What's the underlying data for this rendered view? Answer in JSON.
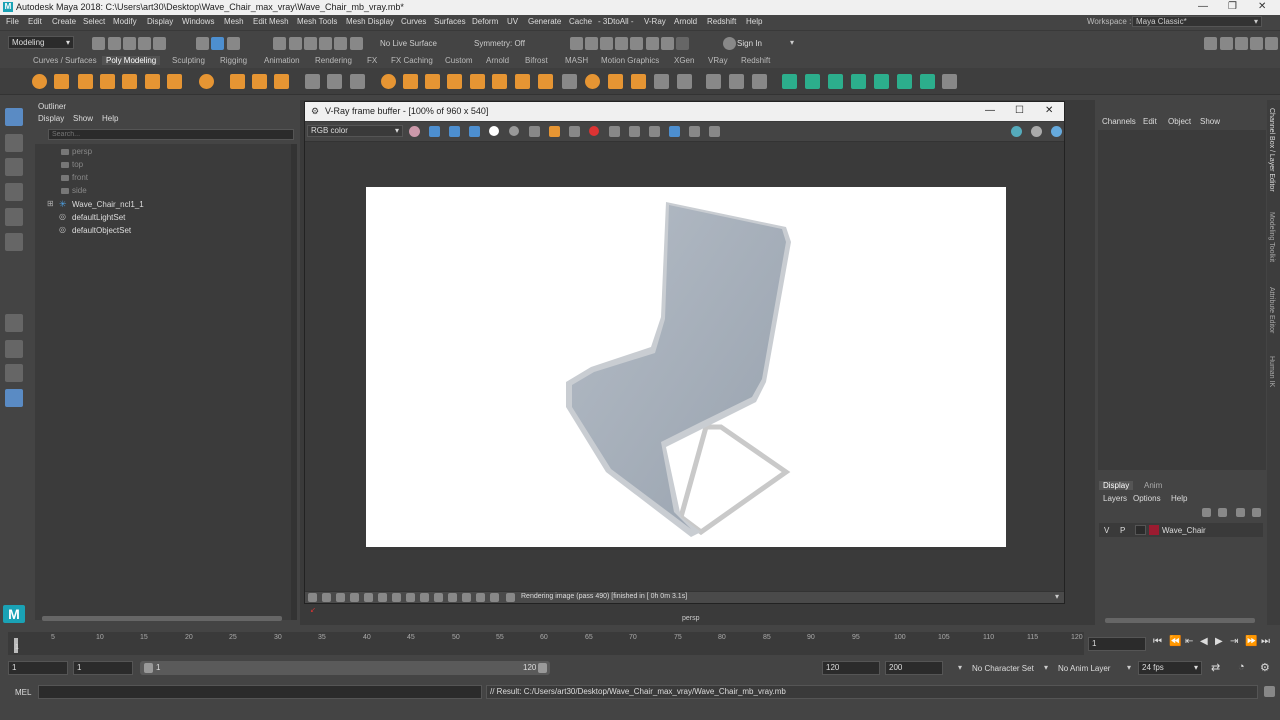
{
  "title": "Autodesk Maya 2018: C:\\Users\\art30\\Desktop\\Wave_Chair_max_vray\\Wave_Chair_mb_vray.mb*",
  "menu": [
    "File",
    "Edit",
    "Create",
    "Select",
    "Modify",
    "Display",
    "Windows",
    "Mesh",
    "Edit Mesh",
    "Mesh Tools",
    "Mesh Display",
    "Curves",
    "Surfaces",
    "Deform",
    "UV",
    "Generate",
    "Cache",
    "- 3DtoAll -",
    "V-Ray",
    "Arnold",
    "Redshift",
    "Help"
  ],
  "workspace": {
    "label": "Workspace :",
    "value": "Maya Classic*"
  },
  "status": {
    "mode": "Modeling",
    "live_surface": "No Live Surface",
    "symmetry": "Symmetry: Off",
    "sign_in": "Sign In"
  },
  "shelf_tabs": [
    "Curves / Surfaces",
    "Poly Modeling",
    "Sculpting",
    "Rigging",
    "Animation",
    "Rendering",
    "FX",
    "FX Caching",
    "Custom",
    "Arnold",
    "Bifrost",
    "MASH",
    "Motion Graphics",
    "XGen",
    "VRay",
    "Redshift"
  ],
  "outliner": {
    "title": "Outliner",
    "menu": [
      "Display",
      "Show",
      "Help"
    ],
    "search_placeholder": "Search...",
    "items": [
      "persp",
      "top",
      "front",
      "side",
      "Wave_Chair_ncl1_1",
      "defaultLightSet",
      "defaultObjectSet"
    ]
  },
  "vfb": {
    "title": "V-Ray frame buffer - [100% of 960 x 540]",
    "channel": "RGB color",
    "status_text": "Rendering image (pass 490) [finished in [ 0h  0m  3.1s]",
    "camera": "persp"
  },
  "channelbox": {
    "menu": [
      "Channels",
      "Edit",
      "Object",
      "Show"
    ]
  },
  "layers": {
    "tabs": [
      "Display",
      "Anim"
    ],
    "menu": [
      "Layers",
      "Options",
      "Help"
    ],
    "layer": {
      "v": "V",
      "p": "P",
      "name": "Wave_Chair",
      "color": "#9b1b30"
    }
  },
  "right_strip": [
    "Channel Box / Layer Editor",
    "Modeling Toolkit",
    "Attribute Editor",
    "Human IK"
  ],
  "timeline": {
    "ticks": [
      "1",
      "5",
      "10",
      "15",
      "20",
      "25",
      "30",
      "35",
      "40",
      "45",
      "50",
      "55",
      "60",
      "65",
      "70",
      "75",
      "80",
      "85",
      "90",
      "95",
      "100",
      "105",
      "110",
      "115",
      "120"
    ],
    "current": "1"
  },
  "range": {
    "start": "1",
    "start2": "1",
    "slider_start": "1",
    "slider_end": "120",
    "end": "120",
    "end2": "200",
    "character_set": "No Character Set",
    "anim_layer": "No Anim Layer",
    "fps": "24 fps"
  },
  "cmd": {
    "mode": "MEL",
    "result": "// Result: C:/Users/art30/Desktop/Wave_Chair_max_vray/Wave_Chair_mb_vray.mb"
  }
}
